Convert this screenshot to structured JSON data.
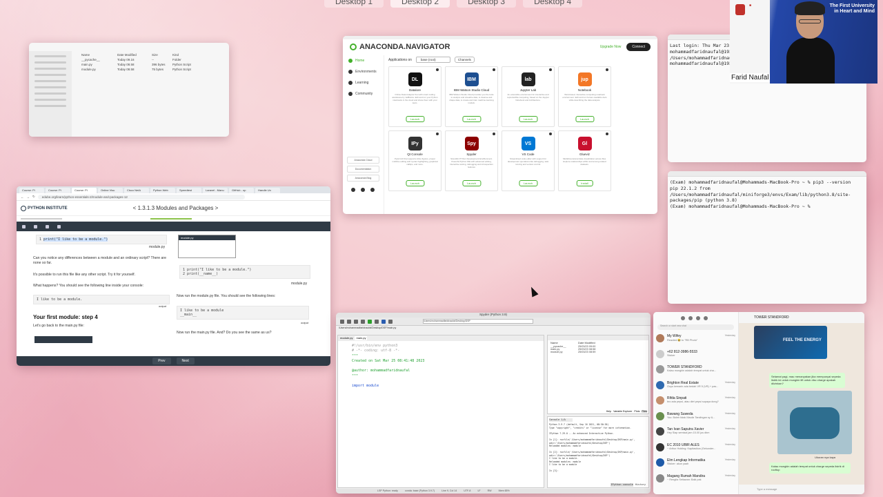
{
  "spaces": [
    "Desktop 1",
    "Desktop 2",
    "Desktop 3",
    "Desktop 4"
  ],
  "finder": {
    "headers": [
      "Name",
      "Date Modified",
      "Size",
      "Kind"
    ],
    "files": [
      {
        "name": "__pycache__",
        "date": "Today 09.16",
        "size": "--",
        "kind": "Folder"
      },
      {
        "name": "main.py",
        "date": "Today 08.58",
        "size": "396 bytes",
        "kind": "Python Script"
      },
      {
        "name": "module.py",
        "date": "Today 08.58",
        "size": "75 bytes",
        "kind": "Python Script"
      }
    ]
  },
  "anaconda": {
    "window_title": "Anaconda Navigator",
    "brand": "ANACONDA.NAVIGATOR",
    "upgrade": "Upgrade Now",
    "connect": "Connect",
    "nav": [
      "Home",
      "Environments",
      "Learning",
      "Community"
    ],
    "side_cards": [
      "Anaconda Cloud",
      "Documentation",
      "Anaconda Blog"
    ],
    "apps_on_label": "Applications on",
    "env": "base (root)",
    "channels": "Channels",
    "apps": [
      {
        "icon": "DL",
        "name": "Datalore",
        "desc": "Online Data Analysis Tool with smart coding assistance by JetBrains. Edit and run your Python notebooks in the cloud and share them with your team.",
        "action": "Launch",
        "color": "#111"
      },
      {
        "icon": "IBM",
        "name": "IBM Watson Studio Cloud",
        "desc": "IBM Watson Studio Cloud provides you the tools to analyze and visualize data, to cleanse and shape data, to create and train machine learning models.",
        "action": "Launch",
        "color": "#1d4f91"
      },
      {
        "icon": "lab",
        "name": "Jupyter Lab",
        "desc": "An extensible environment for interactive and reproducible computing, based on the Jupyter Notebook and Architecture.",
        "action": "Launch",
        "color": "#222"
      },
      {
        "icon": "jup",
        "name": "Notebook",
        "desc": "Web-based, interactive computing notebook environment. Edit and run human-readable docs while describing the data analysis.",
        "action": "Launch",
        "color": "#f37726"
      },
      {
        "icon": "IPy",
        "name": "Qt Console",
        "desc": "PyQt GUI that supports inline figures, proper multiline editing with syntax highlighting, graphical calltips, and more.",
        "action": "Launch",
        "color": "#333"
      },
      {
        "icon": "Spy",
        "name": "Spyder",
        "desc": "Scientific PYthon Development EnviRonment. Powerful Python IDE with advanced editing, interactive testing, debugging and introspection features",
        "action": "Launch",
        "color": "#8c0000"
      },
      {
        "icon": "VS",
        "name": "VS Code",
        "desc": "Streamlined code editor with support for development operations like debugging, task running and version control.",
        "action": "Launch",
        "color": "#0078d4"
      },
      {
        "icon": "Gl",
        "name": "Glueviz",
        "desc": "Multidimensional data visualization across files. Explore relationships within and among related datasets.",
        "action": "Install",
        "color": "#c8102e"
      }
    ]
  },
  "term1": {
    "text": "Last login: Thu Mar 23 13...\nmohammadfaridnaufal@192 p...\n/Users/mohammadfaridnaufal...\nmohammadfaridnaufal@192 p..."
  },
  "term2": {
    "text": "(Exam) mohammadfaridnaufal@Mohammads-MacBook-Pro ~ % pip3 --version\npip 22.1.2 from /Users/mohammadfaridnaufal/miniforge3/envs/Exam/lib/python3.8/site-packages/pip (python 3.8)\n(Exam) mohammadfaridnaufal@Mohammads-MacBook-Pro ~ % "
  },
  "webcam": {
    "name": "Farid Naufal",
    "tagline": "The First University\nin Heart and Mind"
  },
  "browser": {
    "tabs": [
      "Course: Pi",
      "Course: Pi",
      "Course: Pi",
      "Online Visu",
      "Cisco NetA",
      "Python Web",
      "Speedtest",
      "Laravel - Manu",
      "GitHub - op",
      "Handle Un"
    ],
    "url": "edube.org/learn/python-essentials-2/module-and-packages-12",
    "brand": "PYTHON INSTITUTE",
    "lesson_title": "1.3.1.3 Modules and Packages",
    "code_line": "print(\"I like to be a module.\")",
    "file_label": "module.py",
    "p1": "Can you notice any differences between a module and an ordinary script? There are none so far.",
    "p2": "It's possible to run this file like any other script. Try it for yourself.",
    "p3": "What happens? You should see the following line inside your console:",
    "output1": "I like to be a module.",
    "output_label": "output",
    "step_heading": "Your first module: step 4",
    "p4": "Let's go back to the main.py file:",
    "mini_title": "module.py",
    "code2_line1": "print(\"I like to be a module.\")",
    "code2_line2": "print(__name__)",
    "p5": "Now run the module.py file. You should see the following lines:",
    "output2_line1": "I like to be a module",
    "output2_line2": "__main__",
    "p6": "Now run the main.py file. And? Do you see the same as us?",
    "prev": "Prev",
    "next": "Next"
  },
  "spyder": {
    "title": "Spyder (Python 3.9)",
    "path": "/Users/mohammadfaridnaufal/Desktop/DSP",
    "editor_path": "/Users/mohammadfaridnaufal/Desktop/DSP/main.py",
    "tabs": [
      "module.py",
      "main.py"
    ],
    "lines": [
      "#!/usr/bin/env python3",
      "# -*- coding: utf-8 -*-",
      "\"\"\"",
      "Created on Sat Mar 25 08:41:48 2023",
      "",
      "@author: mohammadfaridnaufal",
      "\"\"\"",
      "",
      "import module"
    ],
    "files_header": [
      "Name",
      "Date Modified"
    ],
    "files": [
      {
        "name": "__pycache__",
        "date": "25/03/23 09:00"
      },
      {
        "name": "main.py",
        "date": "25/03/23 08:58"
      },
      {
        "name": "module.py",
        "date": "25/03/23 08:59"
      }
    ],
    "pane_tabs": [
      "Help",
      "Variable Explorer",
      "Plots",
      "Files"
    ],
    "console_tab": "Console 1/A",
    "console": "Python 3.9.7 (default, Sep 16 2021, 08:50:36)\nType \"copyright\", \"credits\" or \"license\" for more information.\n\nIPython 7.29.0 -- An enhanced Interactive Python.\n\nIn [1]: runfile('/Users/mohammadfaridnaufal/Desktop/DSP/main.py', wdir='/Users/mohammadfaridnaufal/Desktop/DSP')\nReloaded modules: module\n\nIn [2]: runfile('/Users/mohammadfaridnaufal/Desktop/DSP/main.py', wdir='/Users/mohammadfaridnaufal/Desktop/DSP')\nI like to be a module.\nReloaded modules: module\nI like to be a module\n\nIn [3]:",
    "bottom_tabs": [
      "IPython console",
      "History"
    ],
    "status": [
      "LSP Python: ready",
      "conda: base (Python 3.9.7)",
      "Line 9, Col 14",
      "UTF-8",
      "LF",
      "RW",
      "Mem 65%"
    ]
  },
  "whatsapp": {
    "search_placeholder": "Search or start new chat",
    "chats": [
      {
        "name": "My Wifey",
        "msg": "Reacted 😂 to \"RB Photo\"",
        "date": "Yesterday",
        "color": "#b07a5a"
      },
      {
        "name": "+62 812-3986-5533",
        "msg": "Sticker",
        "date": "",
        "color": "#ccc"
      },
      {
        "name": "TOWER STANDFORD",
        "msg": "Kalau mungkin adalah tempat untuk cha...",
        "date": "",
        "color": "#999"
      },
      {
        "name": "Brighton Real Estate",
        "msg": "Guys kemarin ada bedah VR 5 (VR) + pas...",
        "date": "Yesterday",
        "color": "#2f6ab0"
      },
      {
        "name": "Rifda Sinpati",
        "msg": "bro ada pepsi, atau diet pepsi supaya dong?",
        "date": "Yesterday",
        "color": "#c58f6d"
      },
      {
        "name": "Bawang Suweda",
        "msg": "You: Boleh tidak Mauliz Tandingan sy &...",
        "date": "Yesterday",
        "color": "#6a8f4e"
      },
      {
        "name": "Tan Ivan Saputra Xavier",
        "msg": "Hey Siap semisal jam 15.00 jus dbm",
        "date": "Yesterday",
        "color": "#444"
      },
      {
        "name": "EC 2010 UBIR ALES",
        "msg": "~ Arthur Holding: Kapitasikus (Sekunder...",
        "date": "Yesterday",
        "color": "#333"
      },
      {
        "name": "Elm Lengkap Informatika",
        "msg": "Sticker: akun yaah",
        "date": "Yesterday",
        "color": "#1e5aa8"
      },
      {
        "name": "Magang Rumah Mandira",
        "msg": "~ Rengila Setiawan: Baik pak",
        "date": "Yesterday",
        "color": "#888"
      }
    ],
    "contact": "TOWER STANDFORD",
    "sticker_text": "FEEL THE ENERGY",
    "bubble1": "Selamat pagi, mau menanyakan jika mempunyai sepeda listrik ini untuk mungkin lift untuk disc charge apakah diizinkan?",
    "caption": "Ukuran nya kaya",
    "bubble2": "Kalau mungkin adalah tempat untuk charge sepeda listrik di rooftop",
    "input_placeholder": "Type a message"
  }
}
